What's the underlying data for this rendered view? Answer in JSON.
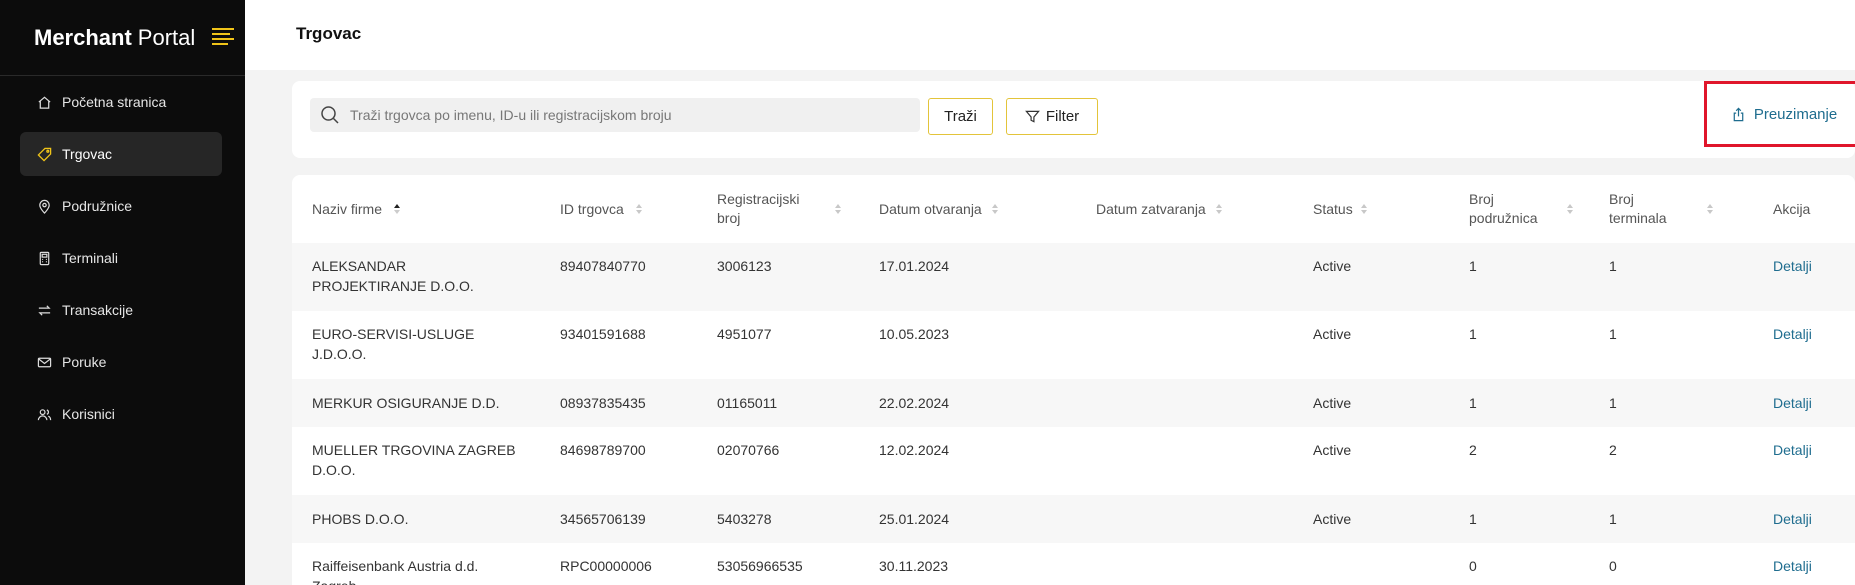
{
  "brand": {
    "strong": "Merchant",
    "light": "Portal"
  },
  "nav": [
    {
      "label": "Početna stranica",
      "icon": "home-icon"
    },
    {
      "label": "Trgovac",
      "icon": "tag-icon",
      "active": true
    },
    {
      "label": "Podružnice",
      "icon": "location-pin-icon"
    },
    {
      "label": "Terminali",
      "icon": "terminal-icon"
    },
    {
      "label": "Transakcije",
      "icon": "transfer-arrows-icon"
    },
    {
      "label": "Poruke",
      "icon": "mail-icon"
    },
    {
      "label": "Korisnici",
      "icon": "users-icon"
    }
  ],
  "header": {
    "title": "Trgovac"
  },
  "toolbar": {
    "search_placeholder": "Traži trgovca po imenu, ID-u ili registracijskom broju",
    "search_label": "Traži",
    "filter_label": "Filter",
    "download_label": "Preuzimanje"
  },
  "table": {
    "columns": [
      {
        "label": "Naziv firme",
        "sort": "asc"
      },
      {
        "label": "ID trgovca",
        "sort": "none"
      },
      {
        "label": "Registracijski broj",
        "sort": "none"
      },
      {
        "label": "Datum otvaranja",
        "sort": "none"
      },
      {
        "label": "Datum zatvaranja",
        "sort": "none"
      },
      {
        "label": "Status",
        "sort": "none"
      },
      {
        "label": "Broj podružnica",
        "sort": "none"
      },
      {
        "label": "Broj terminala",
        "sort": "none"
      },
      {
        "label": "Akcija"
      }
    ],
    "rows": [
      {
        "name": "ALEKSANDAR PROJEKTIRANJE D.O.O.",
        "id": "89407840770",
        "reg": "3006123",
        "opened": "17.01.2024",
        "closed": "",
        "status": "Active",
        "branches": "1",
        "terminals": "1",
        "action": "Detalji"
      },
      {
        "name": "EURO-SERVISI-USLUGE J.D.O.O.",
        "id": "93401591688",
        "reg": "4951077",
        "opened": "10.05.2023",
        "closed": "",
        "status": "Active",
        "branches": "1",
        "terminals": "1",
        "action": "Detalji"
      },
      {
        "name": "MERKUR OSIGURANJE D.D.",
        "id": "08937835435",
        "reg": "01165011",
        "opened": "22.02.2024",
        "closed": "",
        "status": "Active",
        "branches": "1",
        "terminals": "1",
        "action": "Detalji"
      },
      {
        "name": "MUELLER TRGOVINA ZAGREB D.O.O.",
        "id": "84698789700",
        "reg": "02070766",
        "opened": "12.02.2024",
        "closed": "",
        "status": "Active",
        "branches": "2",
        "terminals": "2",
        "action": "Detalji"
      },
      {
        "name": "PHOBS D.O.O.",
        "id": "34565706139",
        "reg": "5403278",
        "opened": "25.01.2024",
        "closed": "",
        "status": "Active",
        "branches": "1",
        "terminals": "1",
        "action": "Detalji"
      },
      {
        "name": "Raiffeisenbank Austria d.d. Zagreb",
        "id": "RPC00000006",
        "reg": "53056966535",
        "opened": "30.11.2023",
        "closed": "",
        "status": "",
        "branches": "0",
        "terminals": "0",
        "action": "Detalji"
      }
    ]
  }
}
